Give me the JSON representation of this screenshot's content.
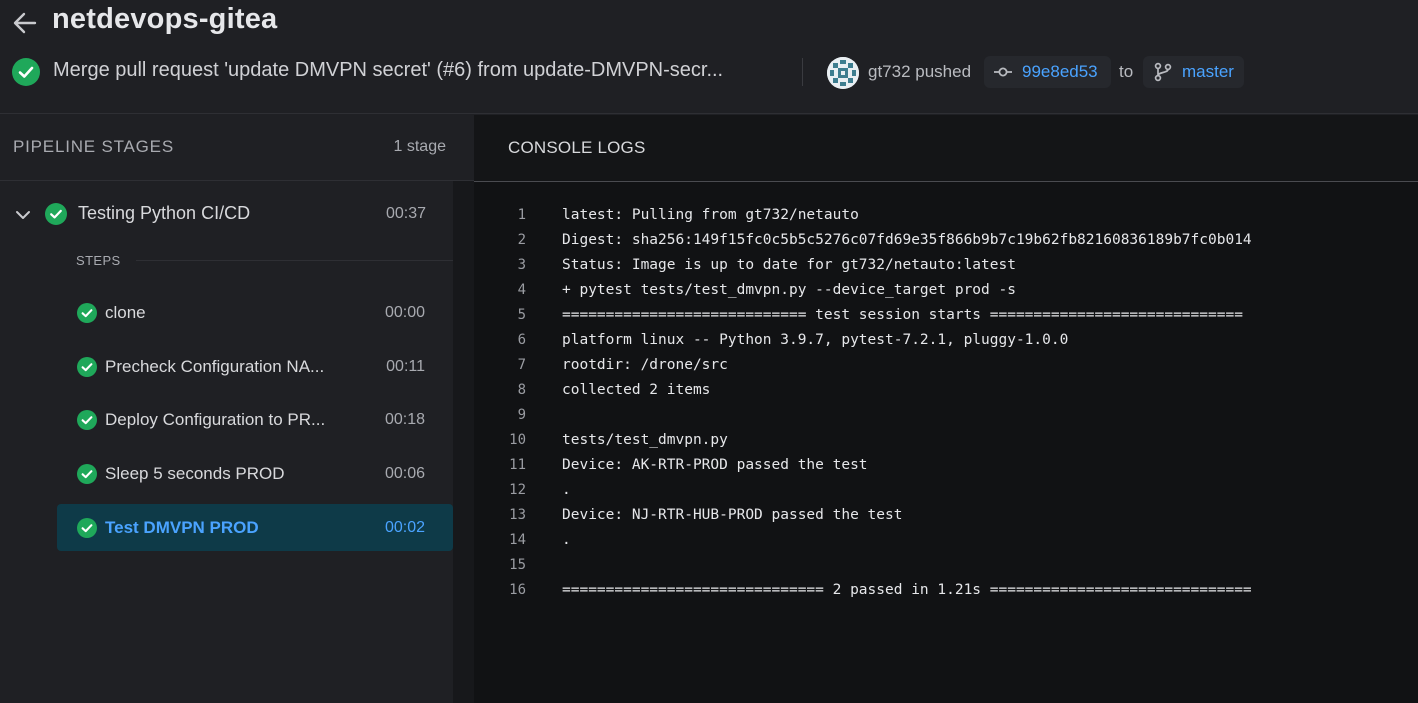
{
  "header": {
    "repo": "netdevops-gitea",
    "commit_message": "Merge pull request 'update DMVPN secret' (#6) from update-DMVPN-secr...",
    "pusher_text": "gt732 pushed",
    "sha": "99e8ed53",
    "to_label": "to",
    "branch": "master"
  },
  "pipeline": {
    "title": "PIPELINE STAGES",
    "count": "1 stage",
    "stage": {
      "name": "Testing Python CI/CD",
      "duration": "00:37",
      "status": "success"
    },
    "steps_label": "STEPS",
    "steps": [
      {
        "name": "clone",
        "duration": "00:00"
      },
      {
        "name": "Precheck Configuration NA...",
        "duration": "00:11"
      },
      {
        "name": "Deploy Configuration to PR...",
        "duration": "00:18"
      },
      {
        "name": "Sleep 5 seconds PROD",
        "duration": "00:06"
      },
      {
        "name": "Test DMVPN PROD",
        "duration": "00:02",
        "active": true
      }
    ]
  },
  "console": {
    "title": "CONSOLE LOGS",
    "lines": [
      {
        "n": "1",
        "text": "latest: Pulling from gt732/netauto"
      },
      {
        "n": "2",
        "text": "Digest: sha256:149f15fc0c5b5c5276c07fd69e35f866b9b7c19b62fb82160836189b7fc0b014"
      },
      {
        "n": "3",
        "text": "Status: Image is up to date for gt732/netauto:latest"
      },
      {
        "n": "4",
        "text": "+ pytest tests/test_dmvpn.py --device_target prod -s"
      },
      {
        "n": "5",
        "text": "============================ test session starts ============================="
      },
      {
        "n": "6",
        "text": "platform linux -- Python 3.9.7, pytest-7.2.1, pluggy-1.0.0"
      },
      {
        "n": "7",
        "text": "rootdir: /drone/src"
      },
      {
        "n": "8",
        "text": "collected 2 items"
      },
      {
        "n": "9",
        "text": ""
      },
      {
        "n": "10",
        "text": "tests/test_dmvpn.py"
      },
      {
        "n": "11",
        "text": "Device: AK-RTR-PROD passed the test"
      },
      {
        "n": "12",
        "text": "."
      },
      {
        "n": "13",
        "text": "Device: NJ-RTR-HUB-PROD passed the test"
      },
      {
        "n": "14",
        "text": "."
      },
      {
        "n": "15",
        "text": ""
      },
      {
        "n": "16",
        "text": "============================== 2 passed in 1.21s =============================="
      }
    ]
  },
  "colors": {
    "success": "#1fa85a",
    "accent": "#4aa3ff",
    "active_bg": "#0e3a48"
  },
  "icons": [
    "back-arrow-icon",
    "success-check-icon",
    "commit-icon",
    "branch-icon",
    "chevron-down-icon",
    "avatar"
  ]
}
